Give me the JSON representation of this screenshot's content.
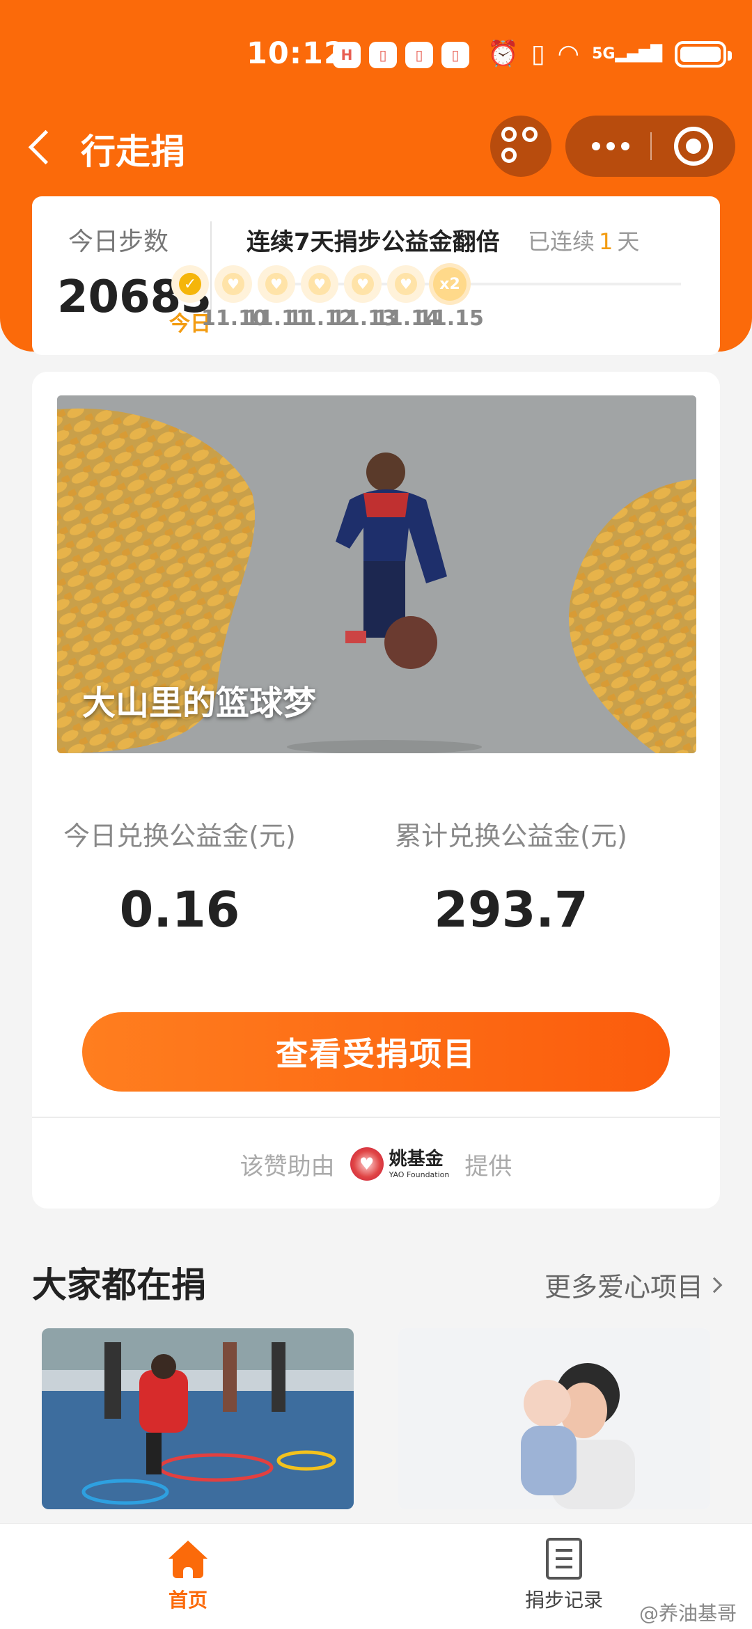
{
  "status_bar": {
    "time": "10:12",
    "network": "5G"
  },
  "nav": {
    "title": "行走捐"
  },
  "steps": {
    "label": "今日步数",
    "value": "20683",
    "streak_title": "连续7天捐步公益金翻倍",
    "streak_prefix": "已连续",
    "streak_days": "1",
    "streak_suffix": "天",
    "days": [
      "今日",
      "11.10",
      "11.11",
      "11.12",
      "11.13",
      "11.14",
      "11.15"
    ],
    "last_badge": "x2"
  },
  "banner": {
    "caption": "大山里的篮球梦"
  },
  "stats": {
    "today_label": "今日兑换公益金(元)",
    "today_value": "0.16",
    "total_label": "累计兑换公益金(元)",
    "total_value": "293.7"
  },
  "cta": {
    "label": "查看受捐项目"
  },
  "sponsor": {
    "prefix": "该赞助由",
    "org_cn": "姚基金",
    "org_en": "YAO Foundation",
    "suffix": "提供"
  },
  "section": {
    "title": "大家都在捐",
    "more": "更多爱心项目"
  },
  "tabs": [
    {
      "label": "首页",
      "icon": "home-icon",
      "active": true
    },
    {
      "label": "捐步记录",
      "icon": "list-icon",
      "active": false
    }
  ],
  "watermark": "@养油基哥",
  "colors": {
    "brand": "#fb6a0a",
    "accent_gold": "#f39c12"
  }
}
